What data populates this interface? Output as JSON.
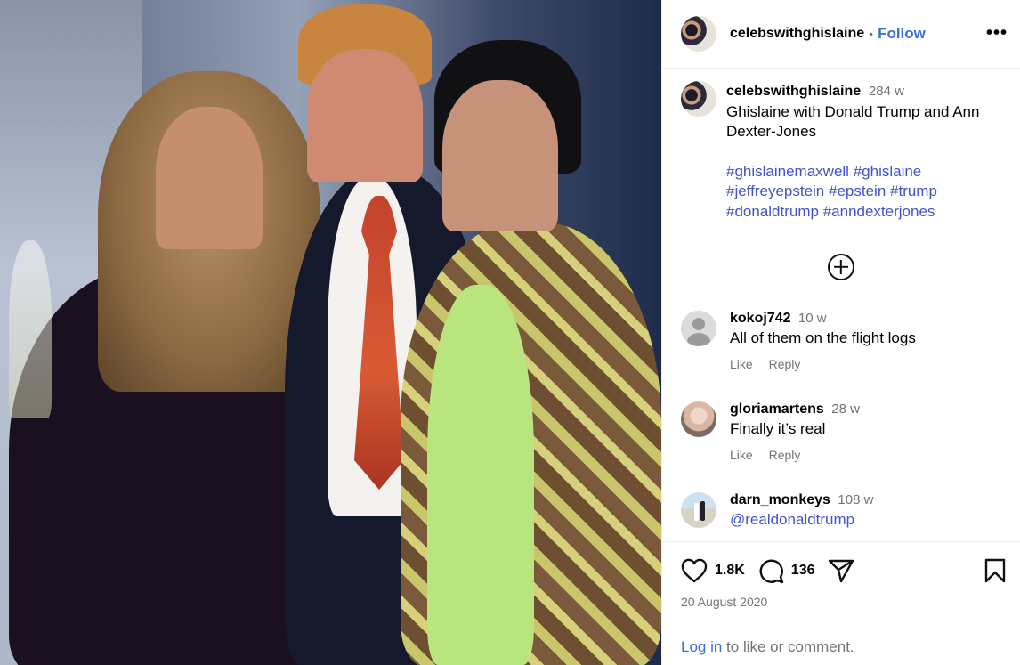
{
  "post": {
    "username": "celebswithghislaine",
    "follow_label": "Follow",
    "more_label": "•••"
  },
  "caption": {
    "username": "celebswithghislaine",
    "age": "284 w",
    "text": "Ghislaine with Donald Trump and Ann Dexter-Jones",
    "hashtags": [
      "#ghislainemaxwell",
      "#ghislaine",
      "#jeffreyepstein",
      "#epstein",
      "#trump",
      "#donaldtrump",
      "#anndexterjones"
    ]
  },
  "comments": [
    {
      "username": "kokoj742",
      "age": "10 w",
      "text": "All of them on the flight logs",
      "like_label": "Like",
      "reply_label": "Reply"
    },
    {
      "username": "gloriamartens",
      "age": "28 w",
      "text": "Finally it’s real",
      "like_label": "Like",
      "reply_label": "Reply"
    },
    {
      "username": "darn_monkeys",
      "age": "108 w",
      "text": "@realdonaldtrump"
    }
  ],
  "stats": {
    "likes": "1.8K",
    "comments": "136",
    "date": "20 August 2020"
  },
  "login": {
    "link": "Log in",
    "rest": " to like or comment."
  },
  "colors": {
    "link_blue": "#3a6fd8",
    "hashtag_blue": "#4153c8",
    "muted_gray": "#737373"
  }
}
